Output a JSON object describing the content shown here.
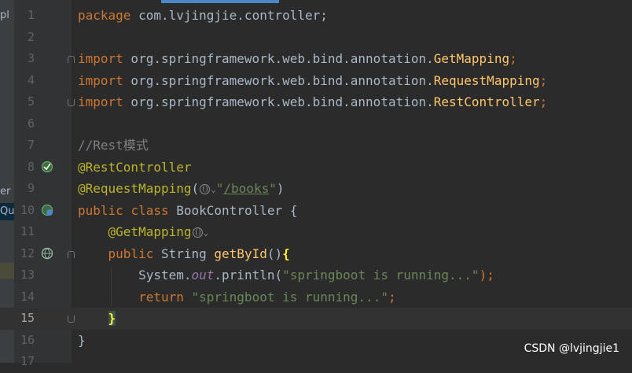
{
  "side_panel": {
    "items": [
      {
        "text": "pl"
      },
      {
        "text": "er"
      },
      {
        "text": "Qu"
      }
    ]
  },
  "lines": [
    {
      "num": "1"
    },
    {
      "num": "2"
    },
    {
      "num": "3"
    },
    {
      "num": "4"
    },
    {
      "num": "5"
    },
    {
      "num": "6"
    },
    {
      "num": "7"
    },
    {
      "num": "8"
    },
    {
      "num": "9"
    },
    {
      "num": "10"
    },
    {
      "num": "11"
    },
    {
      "num": "12"
    },
    {
      "num": "13"
    },
    {
      "num": "14"
    },
    {
      "num": "15"
    },
    {
      "num": "16"
    },
    {
      "num": "17"
    }
  ],
  "code": {
    "l1_kw": "package",
    "l1_rest": " com.lvjingjie.controller;",
    "l3_kw": "import",
    "l3_pkg": " org.springframework.web.bind.annotation.",
    "l3_cls": "GetMapping",
    "l3_semi": ";",
    "l4_kw": "import",
    "l4_pkg": " org.springframework.web.bind.annotation.",
    "l4_cls": "RequestMapping",
    "l4_semi": ";",
    "l5_kw": "import",
    "l5_pkg": " org.springframework.web.bind.annotation.",
    "l5_cls": "RestController",
    "l5_semi": ";",
    "l7_comment": "//Rest模式",
    "l8_ann": "@RestController",
    "l9_ann": "@RequestMapping",
    "l9_open": "(",
    "l9_q1": "\"",
    "l9_url": "/books",
    "l9_q2": "\"",
    "l9_close": ")",
    "l10_kw1": "public",
    "l10_kw2": "class",
    "l10_name": "BookController {",
    "l11_ann": "@GetMapping",
    "l12_kw": "public",
    "l12_type": "String",
    "l12_fn": "getById",
    "l12_paren": "()",
    "l12_brace": "{",
    "l13_a": "System.",
    "l13_out": "out",
    "l13_b": ".println(",
    "l13_str": "\"springboot is running...\"",
    "l13_c": ");",
    "l14_kw": "return",
    "l14_str": "\"springboot is running...\"",
    "l14_semi": ";",
    "l15_brace": "}",
    "l16_brace": "}"
  },
  "watermark": "CSDN @lvjingjie1",
  "colors": {
    "background": "#2b2b2b",
    "keyword": "#cc7832",
    "annotation": "#bbb529",
    "string": "#6a8759",
    "class_ref": "#ffc66d",
    "comment": "#808080"
  }
}
